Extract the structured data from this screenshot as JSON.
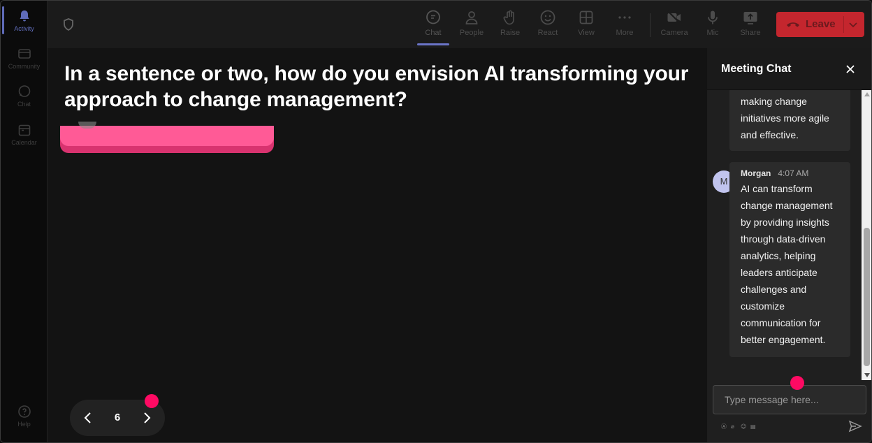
{
  "rail": {
    "items": [
      {
        "label": "Activity"
      },
      {
        "label": "Community"
      },
      {
        "label": "Chat"
      },
      {
        "label": "Calendar"
      },
      {
        "label": "Help"
      }
    ]
  },
  "toolbar": {
    "buttons": [
      {
        "label": "Chat"
      },
      {
        "label": "People"
      },
      {
        "label": "Raise"
      },
      {
        "label": "React"
      },
      {
        "label": "View"
      },
      {
        "label": "More"
      },
      {
        "label": "Camera"
      },
      {
        "label": "Mic"
      },
      {
        "label": "Share"
      }
    ],
    "leave_label": "Leave"
  },
  "stage": {
    "question": "In a sentence or two, how do you envision AI transforming your approach to change management?",
    "page_number": "6"
  },
  "chat": {
    "title": "Meeting Chat",
    "messages": [
      {
        "text": "making change initiatives more agile and effective."
      },
      {
        "author": "Morgan",
        "time": "4:07 AM",
        "initial": "M",
        "text": "AI can transform change management by providing insights through data-driven analytics, helping leaders anticipate challenges and customize communication for better engagement."
      }
    ],
    "input_placeholder": "Type message here..."
  },
  "colors": {
    "accent": "#6b75c8",
    "leave": "#c4262e",
    "pink_card": "#ff5a96",
    "marker": "#ff0a63"
  }
}
